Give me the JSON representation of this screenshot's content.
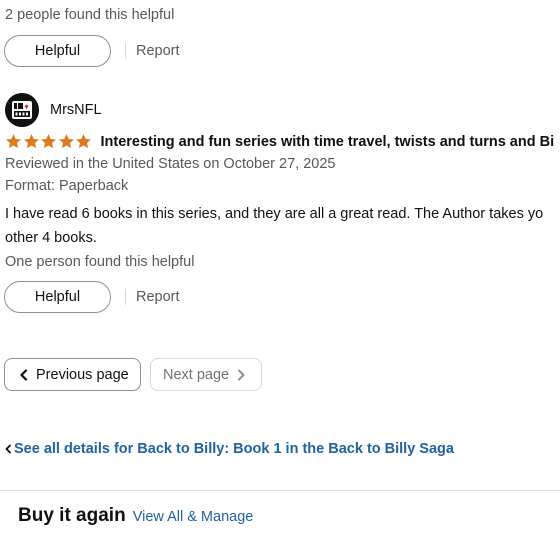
{
  "previous_review": {
    "helpful_count_text": "2 people found this helpful",
    "helpful_label": "Helpful",
    "report_label": "Report"
  },
  "review": {
    "author": "MrsNFL",
    "avatar_text": "FOR LIFE",
    "rating": 5,
    "title": "Interesting and fun series with time travel, twists and turns and Bi",
    "reviewed_in": "Reviewed in the United States on October 27, 2025",
    "format": "Format: Paperback",
    "body_lines": [
      "I have read 6 books in this series, and they are all a great read. The Author takes yo",
      "other 4 books."
    ],
    "helpful_count_text": "One person found this helpful",
    "helpful_label": "Helpful",
    "report_label": "Report"
  },
  "pagination": {
    "previous_label": "Previous page",
    "next_label": "Next page"
  },
  "see_all_link": "See all details for Back to Billy: Book 1 in the Back to Billy Saga",
  "buy_again": {
    "title": "Buy it again",
    "link": "View All & Manage"
  },
  "colors": {
    "star": "#de7921",
    "link": "#2162a1",
    "text": "#0f1111",
    "muted": "#565959",
    "border": "#8d9096"
  }
}
